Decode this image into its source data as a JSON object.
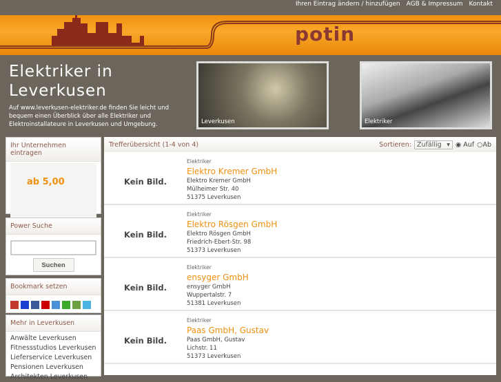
{
  "topnav": [
    "Ihren Eintrag ändern / hinzufügen",
    "AGB & Impressum",
    "Kontakt"
  ],
  "logo": "potin",
  "headline": "Elektriker in Leverkusen",
  "intro": "Auf www.leverkusen-elektriker.de finden Sie leicht und bequem einen Überblick über alle Elektriker und Elektroinstallateure in Leverkusen und Umgebung.",
  "photos": [
    "Leverkusen",
    "Elektriker"
  ],
  "sidebar": {
    "register_title": "Ihr Unternehmen eintragen",
    "register_price": "ab 5,00",
    "search_title": "Power Suche",
    "search_value": "",
    "search_button": "Suchen",
    "bookmark_title": "Bookmark setzen",
    "bookmarks": [
      {
        "name": "mister-wong",
        "color": "#c0392b"
      },
      {
        "name": "delicious",
        "color": "#1a3fd0"
      },
      {
        "name": "facebook",
        "color": "#3b5998"
      },
      {
        "name": "yahoo",
        "color": "#cc0000"
      },
      {
        "name": "google",
        "color": "#4a90d9"
      },
      {
        "name": "technorati",
        "color": "#3caa2a"
      },
      {
        "name": "linkarena",
        "color": "#6aa040"
      },
      {
        "name": "twitter",
        "color": "#4ab3e0"
      }
    ],
    "more_title": "Mehr in Leverkusen",
    "more_links": [
      "Anwälte Leverkusen",
      "Fitnessstudios Leverkusen",
      "Lieferservice Leverkusen",
      "Pensionen Leverkusen",
      "Architekten Leverkusen"
    ]
  },
  "main": {
    "title": "Trefferübersicht (1-4 von 4)",
    "sort_label": "Sortieren:",
    "sort_value": "Zufällig",
    "asc": "Auf",
    "desc": "Ab",
    "no_image": "Kein Bild.",
    "entries": [
      {
        "cat": "Elektriker",
        "name": "Elektro Kremer GmbH",
        "company": "Elektro Kremer GmbH",
        "street": "Mülheimer Str. 40",
        "city": "51375 Leverkusen"
      },
      {
        "cat": "Elektriker",
        "name": "Elektro Rösgen GmbH",
        "company": "Elektro Rösgen GmbH",
        "street": "Friedrich-Ebert-Str. 98",
        "city": "51373 Leverkusen"
      },
      {
        "cat": "Elektriker",
        "name": "ensyger GmbH",
        "company": "ensyger GmbH",
        "street": "Wuppertalstr. 7",
        "city": "51381 Leverkusen"
      },
      {
        "cat": "Elektriker",
        "name": "Paas GmbH, Gustav",
        "company": "Paas GmbH, Gustav",
        "street": "Lichstr. 11",
        "city": "51373 Leverkusen"
      }
    ]
  }
}
